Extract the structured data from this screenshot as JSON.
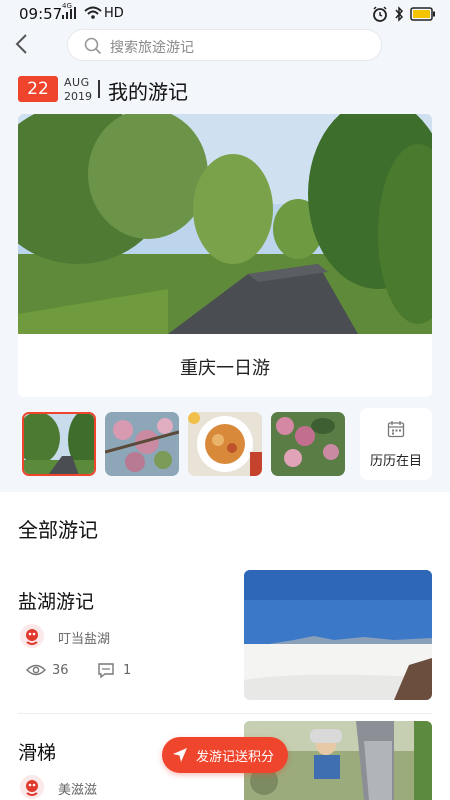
{
  "status_bar": {
    "time": "09:57",
    "signal": "4G",
    "network": "HD"
  },
  "search": {
    "placeholder": "搜索旅途游记"
  },
  "date": {
    "day": "22",
    "month": "AUG",
    "year": "2019"
  },
  "page_title": "我的游记",
  "hero": {
    "caption": "重庆一日游"
  },
  "thumbnails": [
    "road",
    "blossom",
    "food",
    "flowers"
  ],
  "calendar": {
    "label": "历历在目"
  },
  "section_title": "全部游记",
  "items": [
    {
      "title": "盐湖游记",
      "author": "叮当盐湖",
      "views": "36",
      "comments": "1"
    },
    {
      "title": "滑梯",
      "author": "美滋滋"
    }
  ],
  "fab": {
    "label": "发游记送积分"
  },
  "colors": {
    "accent": "#f0452d",
    "background": "#f3f6fa"
  }
}
